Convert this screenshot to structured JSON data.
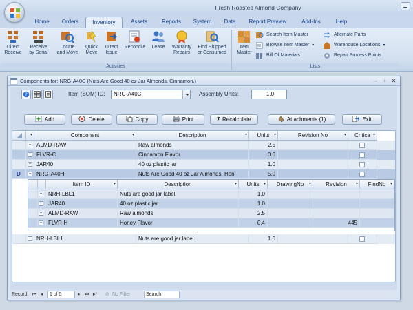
{
  "app": {
    "title": "Fresh Roasted Almond Company"
  },
  "ribbon_tabs": [
    "Home",
    "Orders",
    "Inventory",
    "Assets",
    "Reports",
    "System",
    "Data",
    "Report Preview",
    "Add-Ins",
    "Help"
  ],
  "activities": {
    "label": "Activities",
    "buttons": [
      {
        "line1": "Direct",
        "line2": "Receive",
        "icon": "receive-icon"
      },
      {
        "line1": "Receive",
        "line2": "by Serial",
        "icon": "receive-serial-icon"
      },
      {
        "line1": "Locate",
        "line2": "and Move",
        "icon": "locate-move-icon"
      },
      {
        "line1": "Quick",
        "line2": "Move",
        "icon": "quick-move-icon"
      },
      {
        "line1": "Direct",
        "line2": "Issue",
        "icon": "issue-icon"
      },
      {
        "line1": "Reconcile",
        "line2": "",
        "icon": "reconcile-icon"
      },
      {
        "line1": "Lease",
        "line2": "",
        "icon": "lease-icon"
      },
      {
        "line1": "Warranty",
        "line2": "Repairs",
        "icon": "warranty-icon"
      },
      {
        "line1": "Find Shipped",
        "line2": "or Consumed",
        "icon": "find-shipped-icon"
      }
    ]
  },
  "lists": {
    "label": "Lists",
    "item_master": {
      "line1": "Item",
      "line2": "Master"
    },
    "small": [
      "Search Item Master",
      "Browse Item Master",
      "Bill Of Materials"
    ],
    "small_right": [
      "Alternate Parts",
      "Warehouse Locations",
      "Repair Process Points"
    ]
  },
  "form": {
    "title": "Components for: NRG-A40C (Nuts Are Good 40 oz Jar Almonds. Cinnamon.)",
    "item_bom_label": "Item (BOM) ID:",
    "item_bom_value": "NRG-A40C",
    "assembly_units_label": "Assembly Units:",
    "assembly_units_value": "1.0",
    "buttons": [
      "Add",
      "Delete",
      "Copy",
      "Print",
      "Recalculate",
      "Attachments (1)",
      "Exit"
    ]
  },
  "grid": {
    "columns": [
      "Component",
      "Description",
      "Units",
      "Revision No",
      "Critica"
    ],
    "rows": [
      {
        "component": "ALMD-RAW",
        "description": "Raw almonds",
        "units": "2.5"
      },
      {
        "component": "FLVR-C",
        "description": "Cinnamon Flavor",
        "units": "0.6"
      },
      {
        "component": "JAR40",
        "description": "40 oz plastic jar",
        "units": "1.0"
      },
      {
        "component": "NRG-A40H",
        "description": "Nuts Are Good 40 oz Jar Almonds. Hon",
        "units": "5.0"
      }
    ],
    "sub_columns": [
      "Item ID",
      "Description",
      "Units",
      "DrawingNo",
      "Revision",
      "FindNo"
    ],
    "sub_rows": [
      {
        "item": "NRH-LBL1",
        "description": "Nuts are good jar label.",
        "units": "1.0",
        "drawing": "",
        "revision": "",
        "find": ""
      },
      {
        "item": "JAR40",
        "description": "40 oz plastic jar",
        "units": "1.0",
        "drawing": "",
        "revision": "",
        "find": ""
      },
      {
        "item": "ALMD-RAW",
        "description": "Raw almonds",
        "units": "2.5",
        "drawing": "",
        "revision": "",
        "find": ""
      },
      {
        "item": "FLVR-H",
        "description": "Honey Flavor",
        "units": "0.4",
        "drawing": "",
        "revision": "445",
        "find": ""
      }
    ],
    "last_row": {
      "component": "NRH-LBL1",
      "description": "Nuts are good jar label.",
      "units": "1.0"
    }
  },
  "record_nav": {
    "record_label": "Record:",
    "position": "1 of 5",
    "filter": "No Filter",
    "search": "Search"
  },
  "colors": {
    "accent": "#15428b",
    "selected_row": "#b9cbe4",
    "alt_row": "#e3ebf5"
  }
}
